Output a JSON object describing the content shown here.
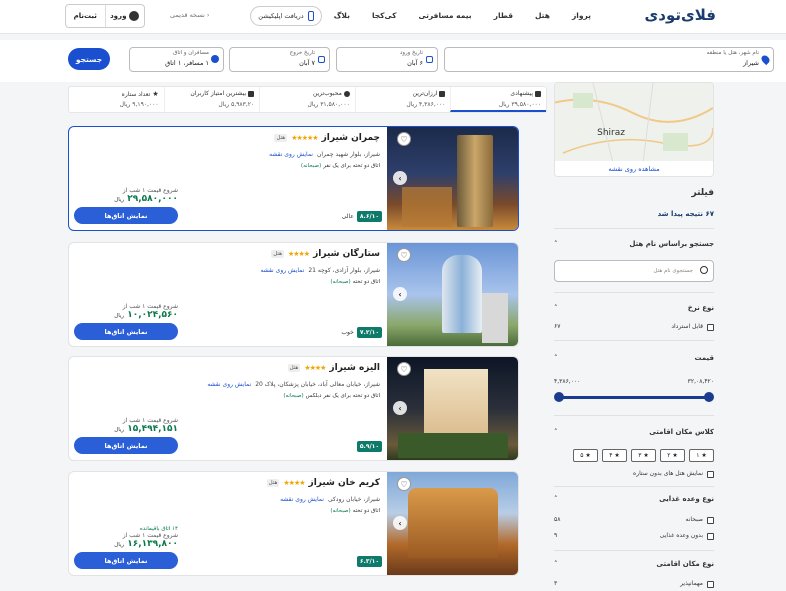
{
  "header": {
    "logo": "فلای‌تودی",
    "nav": [
      "پرواز",
      "هتل",
      "قطار",
      "بیمه مسافرتی",
      "کی‌کجا",
      "بلاگ"
    ],
    "app_button": "دریافت اپلیکیشن",
    "old_version": "نسخه قدیمی",
    "login": "ورود",
    "signup": "ثبت‌نام"
  },
  "search": {
    "destination_label": "نام شهر، هتل یا منطقه",
    "destination_value": "شیراز",
    "checkin_label": "تاریخ ورود",
    "checkin_value": "۶ آبان",
    "checkout_label": "تاریخ خروج",
    "checkout_value": "۷ آبان",
    "guests_label": "مسافران و اتاق",
    "guests_value": "۱ مسافر، ۱ اتاق",
    "submit": "جستجو"
  },
  "sort": [
    {
      "name": "پیشنهادی",
      "price": "۳۹,۵۸۰,۰۰۰ ریال",
      "active": true
    },
    {
      "name": "ارزان‌ترین",
      "price": "۴,۳۸۶,۰۰۰ ریال"
    },
    {
      "name": "محبوب‌ترین",
      "price": "۳۱,۵۸۰,۰۰۰ ریال"
    },
    {
      "name": "بیشترین امتیاز کاربران",
      "price": "۵,۹۸۳,۲۰ ریال"
    },
    {
      "name": "تعداد ستاره",
      "price": "۹,۱۹۰,۰۰۰ ریال"
    }
  ],
  "hotels": [
    {
      "name": "چمران شیراز",
      "type": "هتل",
      "stars": "★★★★★",
      "address": "شیراز، بلوار شهید چمران",
      "map_link": "نمایش روی نقشه",
      "room": "اتاق دو تخته برای یک نفر",
      "meal": "(صبحانه)",
      "score": "۸.۶/۱۰",
      "score_text": "عالی",
      "price_from": "شروع قیمت ۱ شب از",
      "price": "۲۹,۵۸۰,۰۰۰",
      "currency": "ریال",
      "discount": "",
      "button": "نمایش اتاق‌ها"
    },
    {
      "name": "ستارگان شیراز",
      "type": "هتل",
      "stars": "★★★★",
      "address": "شیراز، بلوار آزادی، کوچه 21",
      "map_link": "نمایش روی نقشه",
      "room": "اتاق دو تخته",
      "meal": "(صبحانه)",
      "score": "۷.۲/۱۰",
      "score_text": "خوب",
      "price_from": "شروع قیمت ۱ شب از",
      "price": "۱۰,۰۲۴,۵۶۰",
      "currency": "ریال",
      "discount": "",
      "button": "نمایش اتاق‌ها"
    },
    {
      "name": "الیزه شیراز",
      "type": "هتل",
      "stars": "★★★★",
      "address": "شیراز، خیابان معالی آباد، خیابان پزشکان، پلاک 20",
      "map_link": "نمایش روی نقشه",
      "room": "اتاق دو تخته برای یک نفر دبلکس",
      "meal": "(صبحانه)",
      "score": "۵.۹/۱۰",
      "score_text": "",
      "price_from": "شروع قیمت ۱ شب از",
      "price": "۱۵,۴۹۴,۱۵۱",
      "currency": "ریال",
      "discount": "",
      "button": "نمایش اتاق‌ها"
    },
    {
      "name": "کریم خان شیراز",
      "type": "هتل",
      "stars": "★★★★",
      "address": "شیراز، خیابان رودکی",
      "map_link": "نمایش روی نقشه",
      "room": "اتاق دو تخته",
      "meal": "(صبحانه)",
      "score": "۶.۳/۱۰",
      "score_text": "",
      "price_from": "شروع قیمت ۱ شب از",
      "price": "۱۶,۱۳۹,۸۰۰",
      "currency": "ریال",
      "discount": "۱۴ اتاق باقیمانده",
      "button": "نمایش اتاق‌ها"
    }
  ],
  "sidebar": {
    "map_city": "Shiraz",
    "map_link": "مشاهده روی نقشه",
    "filter_title": "فیلتر",
    "result_count": "۶۷ نتیجه پیدا شد",
    "name_search_title": "جستجو براساس نام هتل",
    "name_search_placeholder": "جستجوی نام هتل",
    "rate_title": "نوع نرخ",
    "rate_option": "قابل استرداد",
    "rate_count": "۶۷",
    "price_title": "قیمت",
    "price_min": "۴,۳۸۶,۰۰۰",
    "price_max": "۳۲,۰۸,۴۲۰",
    "class_title": "کلاس مکان اقامتی",
    "class_stars": [
      "۱",
      "۲",
      "۳",
      "۴",
      "۵"
    ],
    "class_no_star": "نمایش هتل های بدون ستاره",
    "meal_title": "نوع وعده غذایی",
    "meal_options": [
      {
        "label": "صبحانه",
        "count": "۵۸"
      },
      {
        "label": "بدون وعده غذایی",
        "count": "۹"
      }
    ],
    "lodging_title": "نوع مکان اقامتی",
    "lodging_options": [
      {
        "label": "مهمانپذیر",
        "count": "۳"
      }
    ]
  },
  "colors": {
    "primary": "#1a4fd0",
    "score": "#0e7a6a",
    "price": "#0a7a4a",
    "stars": "#f0a500"
  }
}
